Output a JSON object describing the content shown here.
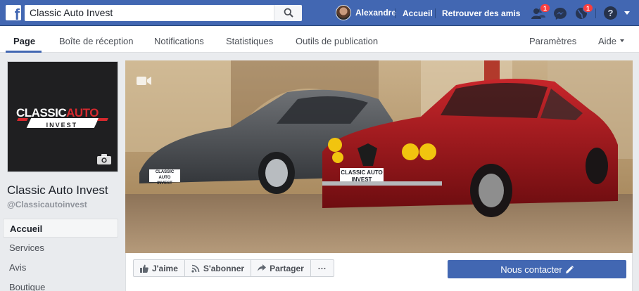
{
  "topbar": {
    "search_value": "Classic Auto Invest",
    "user_name": "Alexandre",
    "home_link": "Accueil",
    "find_friends_link": "Retrouver des amis",
    "friend_requests_badge": "1",
    "notifications_badge": "1",
    "help_symbol": "?",
    "brand_letter": "f"
  },
  "pagenav": {
    "tabs": [
      {
        "label": "Page"
      },
      {
        "label": "Boîte de réception"
      },
      {
        "label": "Notifications"
      },
      {
        "label": "Statistiques"
      },
      {
        "label": "Outils de publication"
      }
    ],
    "settings": "Paramètres",
    "help": "Aide"
  },
  "profile": {
    "logo_word1": "CLASSIC",
    "logo_word2": "AUTO",
    "logo_sub": "INVEST",
    "page_name": "Classic Auto Invest",
    "handle": "@Classicautoinvest"
  },
  "sidebar": {
    "items": [
      {
        "label": "Accueil"
      },
      {
        "label": "Services"
      },
      {
        "label": "Avis"
      },
      {
        "label": "Boutique"
      }
    ]
  },
  "cover": {
    "plate_left_line1": "CLASSIC AUTO",
    "plate_left_line2": "INVEST",
    "plate_right_line1": "CLASSIC AUTO",
    "plate_right_line2": "INVEST"
  },
  "actions": {
    "like": "J'aime",
    "follow": "S'abonner",
    "share": "Partager",
    "more": "···",
    "contact": "Nous contacter"
  },
  "colors": {
    "brand_blue": "#4267b2",
    "badge_red": "#fa3e3e",
    "logo_red": "#d6292e"
  }
}
